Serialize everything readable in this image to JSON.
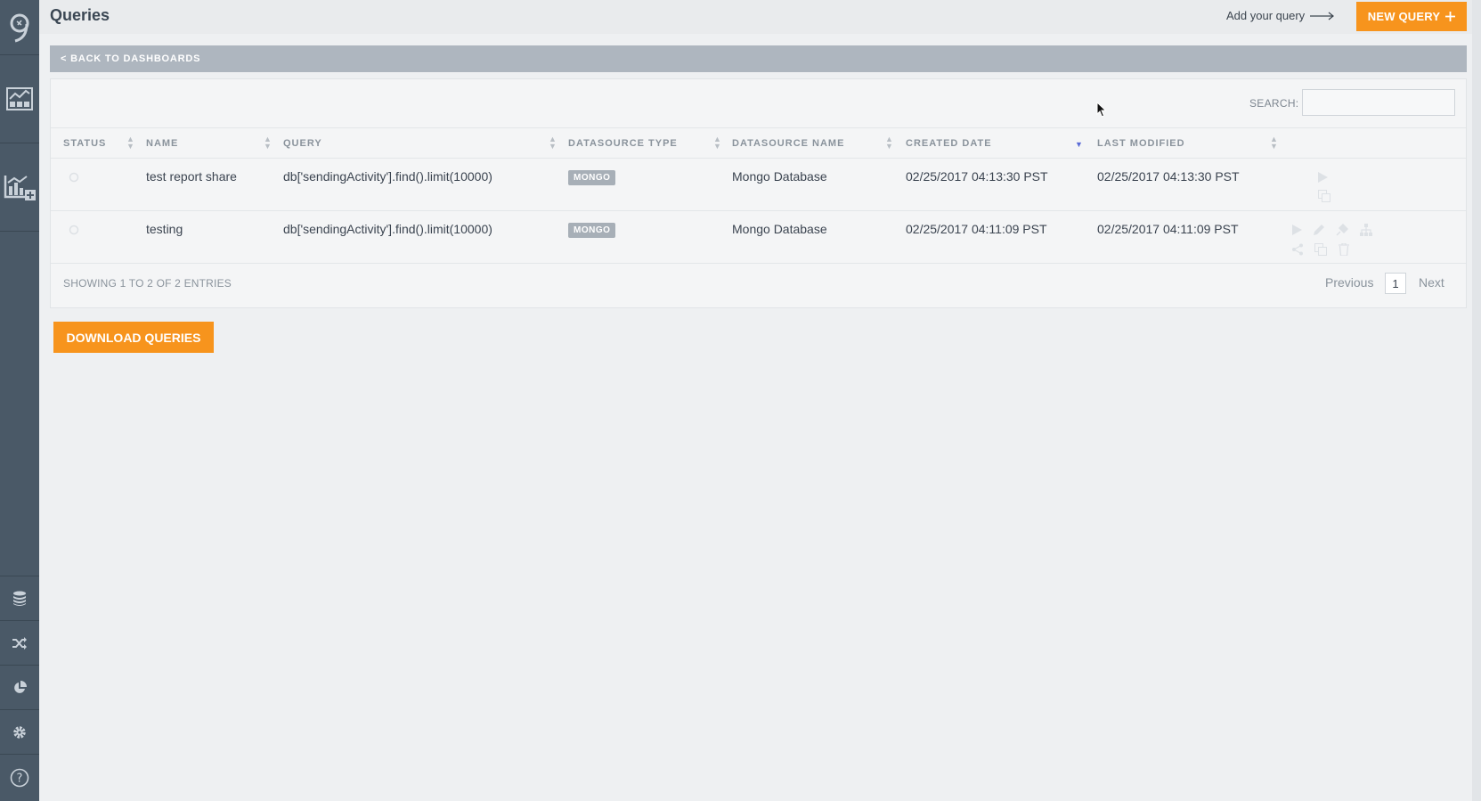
{
  "header": {
    "title": "Queries",
    "add_hint": "Add your query",
    "new_query_label": "NEW QUERY"
  },
  "back_label": "< BACK TO DASHBOARDS",
  "search": {
    "label": "SEARCH:",
    "value": ""
  },
  "table": {
    "columns": [
      "STATUS",
      "NAME",
      "QUERY",
      "DATASOURCE TYPE",
      "DATASOURCE NAME",
      "CREATED DATE",
      "LAST MODIFIED"
    ],
    "rows": [
      {
        "name": "test report share",
        "query": "db['sendingActivity'].find().limit(10000)",
        "ds_type": "MONGO",
        "ds_name": "Mongo Database",
        "created": "02/25/2017 04:13:30 PST",
        "modified": "02/25/2017 04:13:30 PST"
      },
      {
        "name": "testing",
        "query": "db['sendingActivity'].find().limit(10000)",
        "ds_type": "MONGO",
        "ds_name": "Mongo Database",
        "created": "02/25/2017 04:11:09 PST",
        "modified": "02/25/2017 04:11:09 PST"
      }
    ]
  },
  "footer": {
    "info": "SHOWING 1 TO 2 OF 2 ENTRIES",
    "previous": "Previous",
    "current_page": "1",
    "next": "Next"
  },
  "download_label": "DOWNLOAD QUERIES",
  "colors": {
    "accent": "#f7941d",
    "sidebar": "#4a5967",
    "back_bar": "#aeb6bf",
    "badge": "#a7afb7"
  },
  "icons": {
    "sidebar": [
      "logo-icon",
      "dashboard-icon",
      "add-chart-icon",
      "database-icon",
      "shuffle-icon",
      "pie-chart-icon",
      "gear-icon",
      "help-icon"
    ],
    "row_actions": [
      "play-icon",
      "edit-icon",
      "plug-icon",
      "hierarchy-icon",
      "share-icon",
      "copy-icon",
      "trash-icon"
    ]
  }
}
